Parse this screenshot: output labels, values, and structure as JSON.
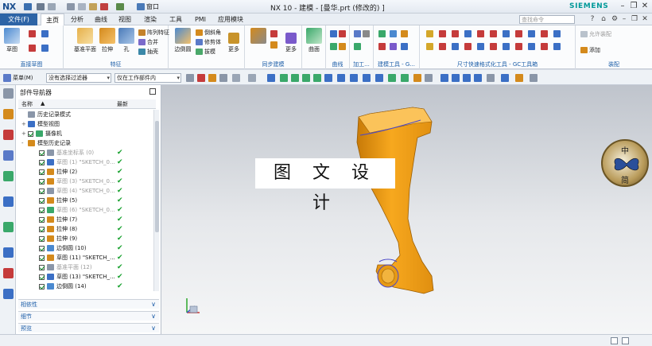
{
  "titlebar": {
    "logo": "NX",
    "window_menu": "窗口",
    "title": "NX 10 - 建模 - [曼华.prt  (修改的) ]",
    "brand": "SIEMENS"
  },
  "menu": {
    "file": "文件(F)",
    "tabs": [
      "主页",
      "分析",
      "曲线",
      "视图",
      "渲染",
      "工具",
      "PMI",
      "应用模块"
    ],
    "active_tab": "主页",
    "search_placeholder": "查找命令"
  },
  "ribbon": {
    "groups": [
      {
        "label": "直接草图",
        "buttons": [
          "草图"
        ]
      },
      {
        "label": "特征",
        "buttons": [
          "基准平面",
          "拉伸",
          "孔"
        ],
        "small": [
          "阵列特征",
          "合并",
          "抽壳"
        ]
      },
      {
        "label": "",
        "buttons": [
          "边倒圆"
        ],
        "small": [
          "倒斜角",
          "修剪体",
          "拔模"
        ],
        "more": "更多"
      },
      {
        "label": "同步建模",
        "buttons": [
          "更多"
        ]
      },
      {
        "label": "",
        "buttons": [
          "曲面"
        ]
      },
      {
        "label": "曲线",
        "buttons": []
      },
      {
        "label": "加工...",
        "buttons": []
      },
      {
        "label": "建模工具 - G...",
        "buttons": []
      },
      {
        "label": "尺寸快速格式化工具 - GC工具箱",
        "buttons": []
      },
      {
        "label": "装配",
        "buttons": [
          "添加"
        ],
        "small": [
          "允许装配"
        ]
      }
    ]
  },
  "selection_bar": {
    "menu": "菜单(M)",
    "filter": "没有选择过滤器",
    "scope": "仅在工作部件内"
  },
  "navigator": {
    "title": "部件导航器",
    "col_name": "名称",
    "col_latest": "最新",
    "rows": [
      {
        "text": "历史记录模式",
        "indent": 1,
        "dim": false,
        "check": false,
        "tick": false
      },
      {
        "text": "模型视图",
        "indent": 1,
        "dim": false,
        "check": false,
        "tick": false,
        "expander": "+"
      },
      {
        "text": "摄像机",
        "indent": 1,
        "dim": false,
        "check": true,
        "tick": false,
        "expander": "+"
      },
      {
        "text": "模型历史记录",
        "indent": 1,
        "dim": false,
        "check": false,
        "tick": false,
        "expander": "-"
      },
      {
        "text": "基准坐标系 (0)",
        "indent": 2,
        "dim": true,
        "check": true,
        "tick": true
      },
      {
        "text": "草图 (1) \"SKETCH_0...",
        "indent": 2,
        "dim": true,
        "check": true,
        "tick": true
      },
      {
        "text": "拉伸 (2)",
        "indent": 2,
        "dim": false,
        "check": true,
        "tick": true
      },
      {
        "text": "草图 (3) \"SKETCH_0...",
        "indent": 2,
        "dim": true,
        "check": true,
        "tick": true
      },
      {
        "text": "草图 (4) \"SKETCH_0...",
        "indent": 2,
        "dim": true,
        "check": true,
        "tick": true
      },
      {
        "text": "拉伸 (5)",
        "indent": 2,
        "dim": false,
        "check": true,
        "tick": true
      },
      {
        "text": "草图 (6) \"SKETCH_0...",
        "indent": 2,
        "dim": true,
        "check": true,
        "tick": true
      },
      {
        "text": "拉伸 (7)",
        "indent": 2,
        "dim": false,
        "check": true,
        "tick": true
      },
      {
        "text": "拉伸 (8)",
        "indent": 2,
        "dim": false,
        "check": true,
        "tick": true
      },
      {
        "text": "拉伸 (9)",
        "indent": 2,
        "dim": false,
        "check": true,
        "tick": true
      },
      {
        "text": "边倒圆 (10)",
        "indent": 2,
        "dim": false,
        "check": true,
        "tick": true
      },
      {
        "text": "草图 (11) \"SKETCH_...",
        "indent": 2,
        "dim": false,
        "check": true,
        "tick": true
      },
      {
        "text": "基准平面 (12)",
        "indent": 2,
        "dim": true,
        "check": true,
        "tick": true
      },
      {
        "text": "草图 (13) \"SKETCH_...",
        "indent": 2,
        "dim": false,
        "check": true,
        "tick": true
      },
      {
        "text": "边倒圆 (14)",
        "indent": 2,
        "dim": false,
        "check": true,
        "tick": true
      }
    ],
    "panels": [
      "相依性",
      "细节",
      "预览"
    ]
  },
  "viewport": {
    "watermark": "图 文 设 计",
    "stamp_top": "中",
    "stamp_bottom": "简",
    "part_color": "#f0a019"
  },
  "colors": {
    "accent": "#2d64a6",
    "group_label": "#1d5ea8",
    "tick": "#15a02c"
  }
}
